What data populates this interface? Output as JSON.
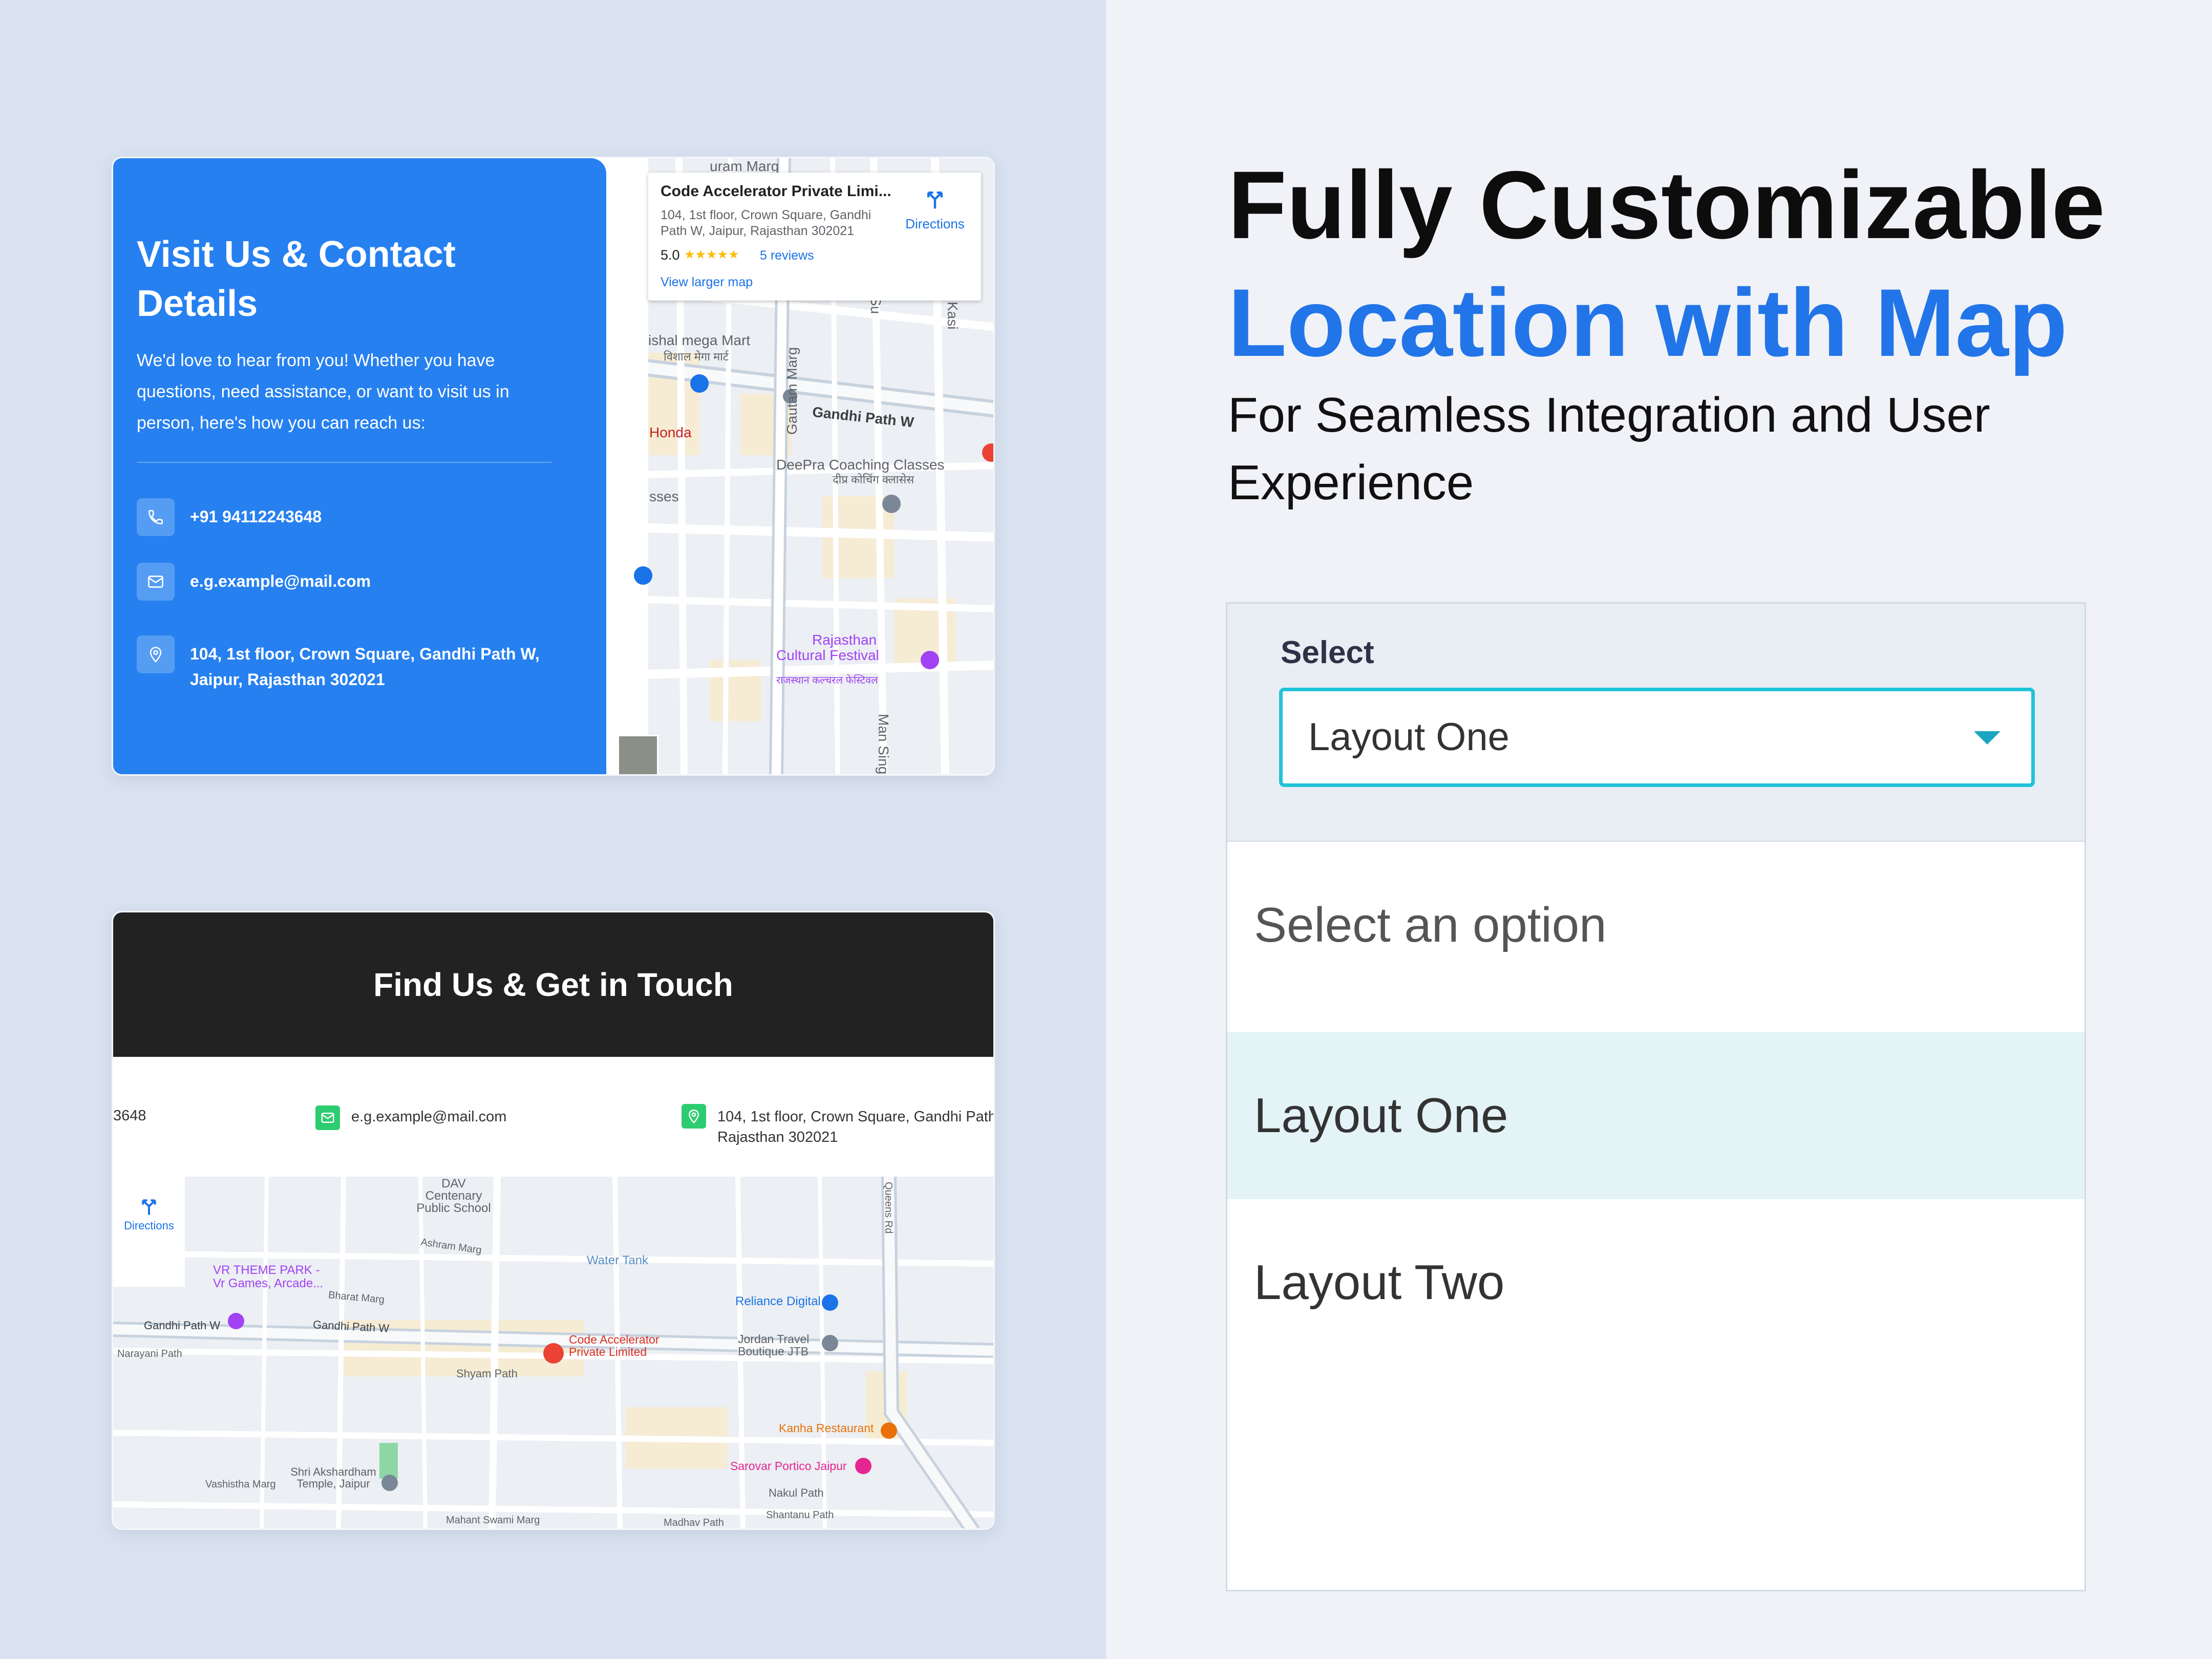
{
  "card_one": {
    "title": "Visit Us & Contact Details",
    "intro": "We'd love to hear from you! Whether you have questions, need assistance, or want to visit us in person, here's how you can reach us:",
    "phone": "+91 94112243648",
    "email": "e.g.example@mail.com",
    "address_line1": "104, 1st floor, Crown Square, Gandhi Path W,",
    "address_line2": "Jaipur, Rajasthan 302021"
  },
  "map_one": {
    "place_name": "Code Accelerator Private Limi...",
    "place_address": "104, 1st floor, Crown Square, Gandhi Path W, Jaipur, Rajasthan 302021",
    "rating": "5.0",
    "stars": "★★★★★",
    "reviews": "5 reviews",
    "larger_map": "View larger map",
    "directions": "Directions",
    "labels": {
      "l1": "ishal mega Mart",
      "l2": "विशाल मेगा मार्ट",
      "l3": "Gautam Marg",
      "l4": "Gandhi Path W",
      "l5": "Honda",
      "l6": "DeePra Coaching Classes",
      "l7": "दीप्र कोचिंग क्लासेस",
      "l8": "sses",
      "l9": "Rajasthan",
      "l10": "Cultural Festival",
      "l11": "राजस्थान कल्चरल फेस्टिवल",
      "l12": "Man Singh",
      "l13": "Kasi",
      "l14": "Su",
      "l15": "uram Marg"
    }
  },
  "card_two": {
    "title": "Find Us & Get in Touch",
    "phone_partial": "3648",
    "email": "e.g.example@mail.com",
    "address_line1": "104, 1st floor, Crown Square, Gandhi Path",
    "address_line2": "Rajasthan 302021",
    "directions": "Directions",
    "labels": {
      "dav": "DAV Centenary Public School",
      "vr": "VR THEME PARK - Vr Games, Arcade...",
      "gandhi1": "Gandhi Path W",
      "gandhi2": "Gandhi Path W",
      "narayani": "Narayani Path",
      "code": "Code Accelerator Private Limited",
      "shyam": "Shyam Path",
      "water": "Water Tank",
      "reliance": "Reliance Digital",
      "jordan": "Jordan Travel Boutique JTB",
      "kanha": "Kanha Restaurant",
      "sarovar": "Sarovar Portico Jaipur",
      "nakul": "Nakul Path",
      "shantanu": "Shantanu Path",
      "madhav": "Madhav Path",
      "mahant": "Mahant Swami Marg",
      "akshardham": "Shri Akshardham Temple, Jaipur",
      "vashistha": "Vashistha Marg",
      "queens": "Queens Rd",
      "ashram": "Ashram Marg",
      "bharat": "Bharat Marg"
    }
  },
  "right": {
    "headline_line1": "Fully Customizable",
    "headline_line2": "Location with Map",
    "subheadline": "For Seamless Integration and User Experience",
    "select_label": "Select",
    "select_value": "Layout One",
    "options": [
      "Select an option",
      "Layout One",
      "Layout Two"
    ]
  },
  "colors": {
    "accent_blue": "#2275e8",
    "contact_blue": "#2680f0",
    "select_border": "#20c4d8",
    "highlight": "#e3f3f6"
  }
}
